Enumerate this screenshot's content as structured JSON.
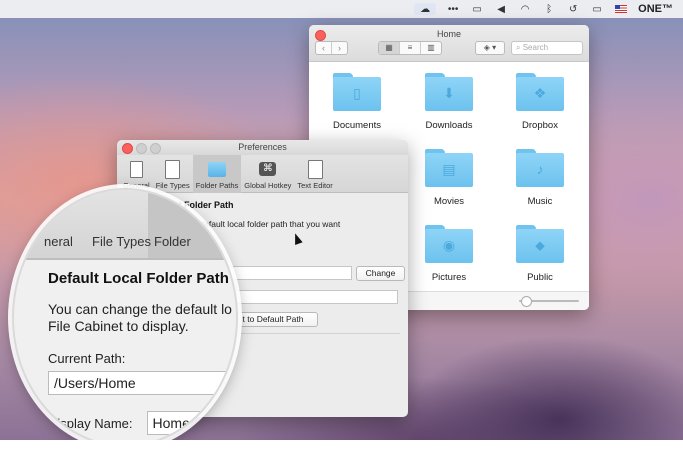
{
  "menubar": {
    "icons": [
      "cloud-icon",
      "ellipsis-icon",
      "airplay-icon",
      "volume-icon",
      "wifi-icon",
      "bluetooth-icon",
      "time-machine-icon",
      "battery-icon",
      "flag-icon"
    ],
    "user": "ONE™"
  },
  "finder": {
    "title": "Home",
    "search_placeholder": "Search",
    "nav_back": "‹",
    "nav_forward": "›",
    "view_modes": [
      "icon-view",
      "list-view",
      "column-view"
    ],
    "items": [
      {
        "label": "Documents",
        "icon": "document-icon"
      },
      {
        "label": "Downloads",
        "icon": "download-icon"
      },
      {
        "label": "Dropbox",
        "icon": "dropbox-icon"
      },
      {
        "label": "Movies",
        "icon": "film-icon"
      },
      {
        "label": "Music",
        "icon": "music-icon"
      },
      {
        "label": "Pictures",
        "icon": "camera-icon"
      },
      {
        "label": "Public",
        "icon": "public-icon"
      }
    ]
  },
  "prefs": {
    "title": "Preferences",
    "tabs": [
      "General",
      "File Types",
      "Folder Paths",
      "Global Hotkey",
      "Text Editor"
    ],
    "active_tab": "Folder Paths",
    "heading": "Default Local Folder Path",
    "desc_1": "change the default local folder path that you want",
    "desc_2": "to display.",
    "change_button": "Change",
    "reset_button": "t to Default Path"
  },
  "magnifier": {
    "tab_1": "neral",
    "tab_2": "File Types",
    "tab_3": "Folder",
    "heading": "Default Local Folder Path",
    "desc_1": "You can change the default lo",
    "desc_2": "File Cabinet to display.",
    "current_path_label": "Current Path:",
    "current_path_value": "/Users/Home",
    "display_name_label": "Display Name:",
    "display_name_value": "Home"
  }
}
